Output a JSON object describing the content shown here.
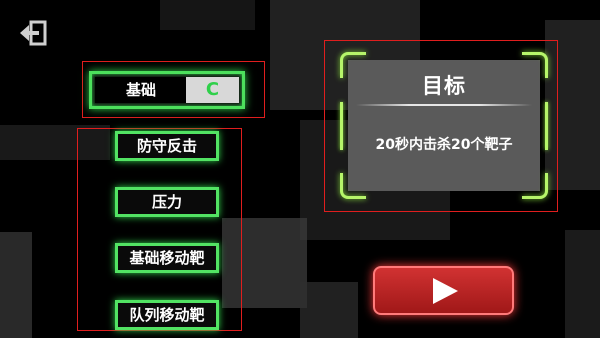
{
  "basic_toggle": {
    "label": "基础",
    "knob": "C"
  },
  "modes": [
    "防守反击",
    "压力",
    "基础移动靶",
    "队列移动靶"
  ],
  "target": {
    "title": "目标",
    "description": "20秒内击杀20个靶子"
  },
  "colors": {
    "neon_green": "#4ce05c",
    "corner_green": "#b6f56a",
    "play_red": "#d13232",
    "frame_red": "#e01e1e"
  },
  "icons": {
    "back": "exit-door-icon",
    "play": "play-triangle-icon"
  }
}
